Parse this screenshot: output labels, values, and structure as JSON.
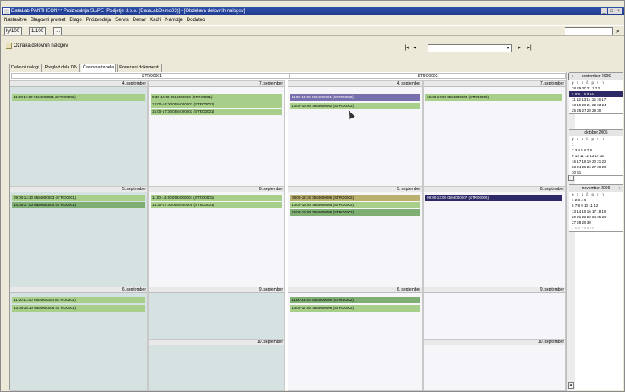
{
  "window": {
    "title": "DataLab PANTHEON™ Proizvodnja SL/PE [Podjetje d.o.o. (DataLabDemo03)] - [Obdelava delovnih nalogov]",
    "minimize": "_",
    "maximize": "□",
    "close": "×"
  },
  "menu": [
    "Nastavitve",
    "Blagovni promet",
    "Blago",
    "Proizvodnja",
    "Servis",
    "Denar",
    "Kadri",
    "Namizje",
    "Dodatno"
  ],
  "toolbar": {
    "btn1": "ly/100",
    "btn2": "1/100",
    "btn3": "..."
  },
  "toolbar2": {
    "object_label": "Oznaka delovnih nalogov",
    "nav_first": "|◂",
    "nav_prev": "◂",
    "nav_next": "▸",
    "nav_last": "▸|",
    "dropdown": "▾"
  },
  "tabs": [
    "Delovni nalogi",
    "Pregled dela DN",
    "Časovna tabela",
    "Povezani dokumenti"
  ],
  "columns": [
    "STRO0001",
    "STRO0002"
  ],
  "day_headers": {
    "c1r1a": "4. september",
    "c1r1b": "7. september",
    "c1r2a": "5. september",
    "c1r2b": "8. september",
    "c1r3a": "6. september",
    "c1r3b": "9. september",
    "c1r3c": "10. september",
    "c2r1a": "4. september",
    "c2r1b": "7. september",
    "c2r2a": "5. september",
    "c2r2b": "8. september",
    "c2r3a": "6. september",
    "c2r3b": "9. september",
    "c2r3c": "10. september"
  },
  "events": {
    "c1r1a_1": "11:00-17:30 0584000001 (STRO0001)",
    "c1r1b_1": "9:30-12:00 0584000003 (STRO0001)",
    "c1r1b_2": "13:00-14:00 0584000007 (STRO0001)",
    "c1r1b_3": "15:00-17:00 0584000003 (STRO0001)",
    "c1r2a_1": "09:00-14:30 0584000003 (STRO0001)",
    "c1r2a_2": "14:00-17:00 0584000004 (STRO0001)",
    "c1r2b_1": "11:00-14:00 0584000004 (STRO0001)",
    "c1r2b_2": "14:30-17:00 0584000005 (STRO0001)",
    "c1r3a_1": "11:00-13:00 0584000004 (STRO0001)",
    "c1r3a_2": "13:00-16:30 0584000006 (STRO0001)",
    "c2r1a_1": "11:00-13:00 0584000001 (STRO0002)",
    "c2r1a_2": "13:00-16:00 0584000002 (STRO0002)",
    "c2r1b_1": "16:00-17:00 0584000003 (STRO0002)",
    "c2r2a_1": "08:00-12:30 0584000005 (STRO0002)",
    "c2r2a_2": "13:00-15:00 0584000005 (STRO0002)",
    "c2r2a_3": "15:00-16:00 0584000005 (STRO0002)",
    "c2r2b_1": "09:00-13:00 0584000007 (STRO0002)",
    "c2r3a_1": "11:00-13:00 0584000008 (STRO0002)",
    "c2r3a_2": "13:00-17:00 0584000008 (STRO0002)"
  },
  "mini_calendars": [
    {
      "title": "september 2006",
      "dow": "p t s č p s n",
      "weeks": [
        "28 29 30 31  1  2  3",
        " 4  5  6  7  8  9 10",
        "11 12 13 14 15 16 17",
        "18 19 20 21 22 23 24",
        "25 26 27 28 29 30"
      ],
      "selected_week": 1
    },
    {
      "title": "oktober 2006",
      "dow": "p t s č p s n",
      "weeks": [
        "                   1",
        " 2  3  4  5  6  7  8",
        " 9 10 11 12 13 14 15",
        "16 17 18 19 20 21 22",
        "23 24 25 26 27 28 29",
        "30 31"
      ],
      "selected_week": -1
    },
    {
      "title": "november 2006",
      "dow": "p t s č p s n",
      "weeks": [
        "       1  2  3  4  5",
        " 6  7  8  9 10 11 12",
        "13 14 15 16 17 18 19",
        "20 21 22 23 24 25 26",
        "27 28 29 30",
        " 4  5  6  7  8  9 10"
      ],
      "selected_week": -1
    }
  ]
}
